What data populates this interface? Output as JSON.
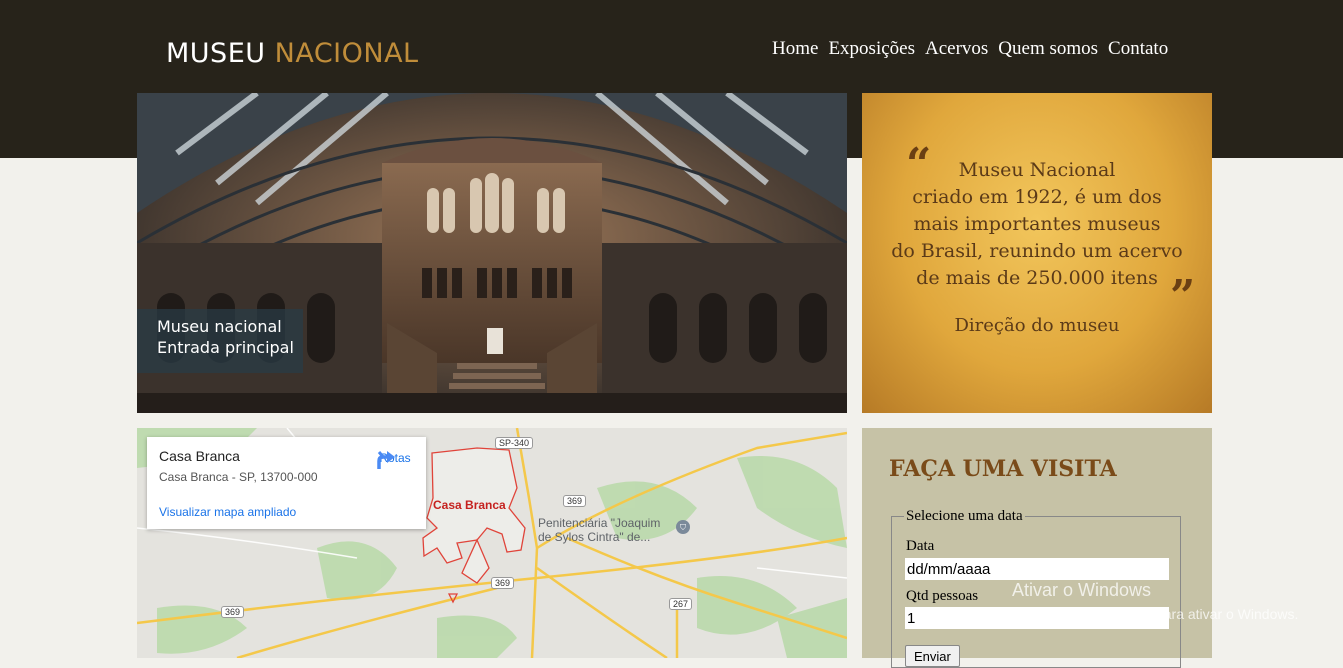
{
  "header": {
    "logo_main": "MUSEU",
    "logo_accent": "NACIONAL",
    "nav": [
      "Home",
      "Exposições",
      "Acervos",
      "Quem somos",
      "Contato"
    ]
  },
  "hero": {
    "caption_line1": "Museu nacional",
    "caption_line2": "Entrada principal"
  },
  "quote": {
    "open_mark": "“",
    "close_mark": "”",
    "lines": [
      "Museu Nacional",
      "criado em 1922, é um dos",
      "mais importantes museus",
      "do Brasil, reunindo um acervo",
      "de mais de 250.000 itens"
    ],
    "author": "Direção do museu"
  },
  "map": {
    "card_title": "Casa Branca",
    "card_address": "Casa Branca - SP, 13700-000",
    "card_link": "Visualizar mapa ampliado",
    "routes_label": "Rotas",
    "place_main": "Casa Branca",
    "place_secondary_line1": "Penitenciária \"Joaquim",
    "place_secondary_line2": "de Sylos Cintra\" de...",
    "road_labels": [
      "SP-340",
      "369",
      "369",
      "369",
      "267"
    ]
  },
  "visit": {
    "title": "FAÇA UMA VISITA",
    "legend": "Selecione uma data",
    "date_label": "Data",
    "date_value": "dd/mm/aaaa",
    "people_label": "Qtd pessoas",
    "people_value": "1",
    "submit_label": "Enviar"
  },
  "watermark": {
    "line1": "Ativar o Windows",
    "line2": "Acesse Configurações para ativar o Windows."
  },
  "colors": {
    "header_bg": "#27231a",
    "logo_accent": "#c08d3a",
    "page_bg": "#f2f1ec",
    "visit_bg": "#c6c2a6",
    "visit_title": "#7a4b19"
  }
}
